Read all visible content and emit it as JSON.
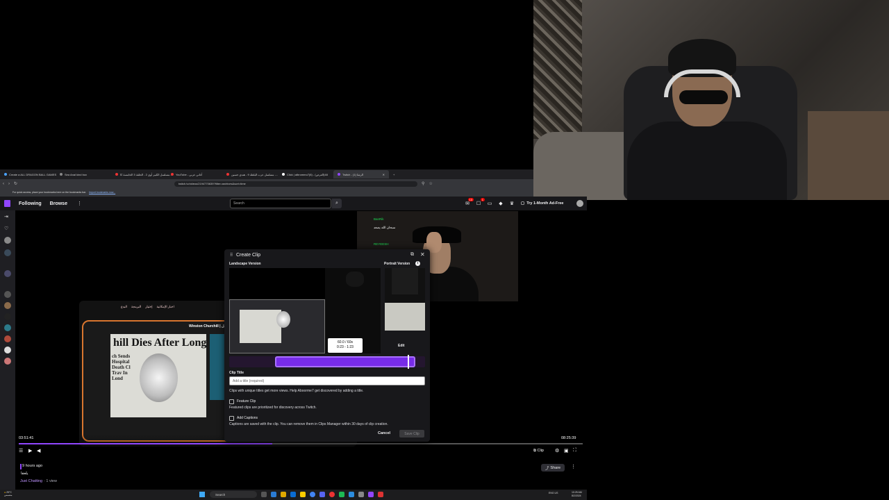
{
  "browser": {
    "tabs": [
      {
        "label": "Create a ALL DRAGON BALL GAMES"
      },
      {
        "label": "Sea Anal kind box"
      },
      {
        "label": "مسلسل الكبير أوي 2 - الحلقة 3 الخامسة كا..."
      },
      {
        "label": "YouTube - أغاني عربي"
      },
      {
        "label": "مسلسل عرب البلطة 9 - هندي حسين -..."
      },
      {
        "label": "Click | albrommo7(8) - (العرض)48"
      },
      {
        "label": "Twitch - الرشا (1)"
      }
    ],
    "url": "twitch.tv/videos/2194770639?filter=archives&sort=time",
    "bookmarks_text": "For quick access, place your bookmarks here on the bookmarks bar.",
    "bookmarks_link": "Import bookmarks now..."
  },
  "twitch_nav": {
    "following": "Following",
    "browse": "Browse",
    "search_placeholder": "Search",
    "notifications_count": "13",
    "inbox_count": "1",
    "ad_free": "Try 1-Month Ad-Free"
  },
  "stream": {
    "chat": [
      {
        "user": "BanRik",
        "text": ""
      },
      {
        "user": "",
        "text": "سبحان الله يصعد"
      },
      {
        "user": "REYEESH",
        "text": ""
      }
    ],
    "overlay_menu": [
      "البدع",
      "البرمجة",
      "إختيار",
      "اخبار الإمكانية"
    ],
    "paper_title": "Winston Churchill | السير ونستون تشرشل",
    "paper_headline": "hill Dies After Long Fi",
    "paper_sub": "ch Sends Hospital Death Cl Trav In Lond",
    "time_current": "03:51:41",
    "time_total": "08:25:39",
    "progress_fraction": 0.45,
    "clip_label": "Clip"
  },
  "clip_modal": {
    "title": "Create Clip",
    "landscape_label": "Landscape Version",
    "portrait_label": "Portrait Version",
    "duration": "60.0 / 60s",
    "range": "0:23 - 1:23",
    "edit": "Edit",
    "clip_title_label": "Clip Title",
    "clip_title_placeholder": "Add a title (required)",
    "title_hint": "Clips with unique titles get more views. Help Aboorme7 get discovered by adding a title.",
    "feature_label": "Feature Clip",
    "feature_hint": "Featured clips are prioritized for discovery across Twitch.",
    "captions_label": "Add Captions",
    "captions_hint": "Captions are saved with the clip. You can remove them in Clips Manager within 30 days of clip creation.",
    "cancel": "Cancel",
    "save": "Save Clip"
  },
  "video_info": {
    "when": "9 hours ago",
    "title": "يلعقا",
    "category": "Just Chatting",
    "views": " · 1 view",
    "share": "Share"
  },
  "taskbar": {
    "weather_temp": "25°C",
    "weather_desc": "مشمس",
    "search": "Search",
    "lang": "ENG US",
    "time": "10:25 AM",
    "date": "8/2/2024"
  },
  "colors": {
    "twitch_purple": "#9146ff",
    "clip_range": "#772ce8",
    "chat_user": "#1cdb53"
  }
}
